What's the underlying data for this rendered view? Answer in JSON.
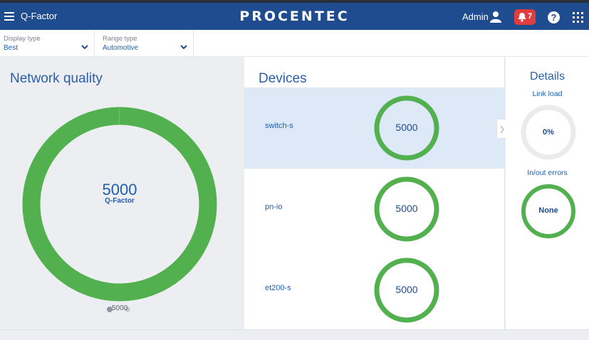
{
  "header": {
    "app_title": "Q-Factor",
    "brand": "PROCENTEC",
    "user_name": "Admin",
    "alerts_count": "7",
    "help_symbol": "?",
    "icons": [
      "menu-icon",
      "user-icon",
      "bell-icon",
      "help-icon",
      "apps-grid-icon"
    ],
    "color": "#1f4b8f"
  },
  "filters": {
    "display_type": {
      "label": "Display type",
      "value": "Best"
    },
    "range_type": {
      "label": "Range type",
      "value": "Automotive"
    }
  },
  "network_quality": {
    "title": "Network quality",
    "value": "5000",
    "caption": "Q-Factor",
    "slider_value": "5000",
    "ring_color": "#53b04f"
  },
  "devices": {
    "title": "Devices",
    "items": [
      {
        "name": "switch-s",
        "value": "5000",
        "selected": true
      },
      {
        "name": "pn-io",
        "value": "5000",
        "selected": false
      },
      {
        "name": "et200-s",
        "value": "5000",
        "selected": false
      }
    ]
  },
  "details": {
    "title": "Details",
    "link_load": {
      "label": "Link load",
      "value": "0%",
      "fraction": 0
    },
    "errors": {
      "label": "In/out errors",
      "value": "None"
    }
  }
}
